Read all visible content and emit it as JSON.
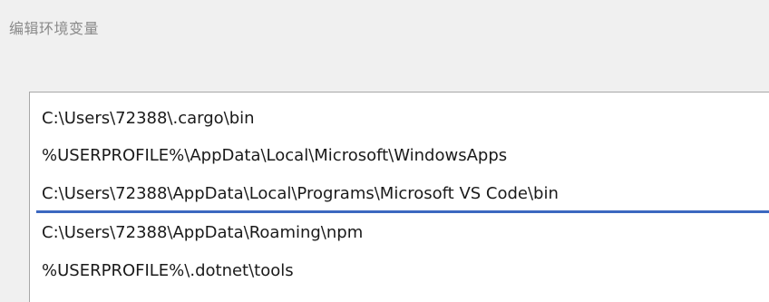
{
  "dialog": {
    "title": "编辑环境变量"
  },
  "path_list": {
    "items": [
      {
        "label": "C:\\Users\\72388\\.cargo\\bin"
      },
      {
        "label": "%USERPROFILE%\\AppData\\Local\\Microsoft\\WindowsApps"
      },
      {
        "label": "C:\\Users\\72388\\AppData\\Local\\Programs\\Microsoft VS Code\\bin"
      },
      {
        "label": "C:\\Users\\72388\\AppData\\Roaming\\npm"
      },
      {
        "label": "%USERPROFILE%\\.dotnet\\tools"
      }
    ]
  },
  "colors": {
    "background": "#f0f0f0",
    "list_background": "#ffffff",
    "drop_indicator": "#3c68c0",
    "title_text": "#8a8a8a"
  }
}
